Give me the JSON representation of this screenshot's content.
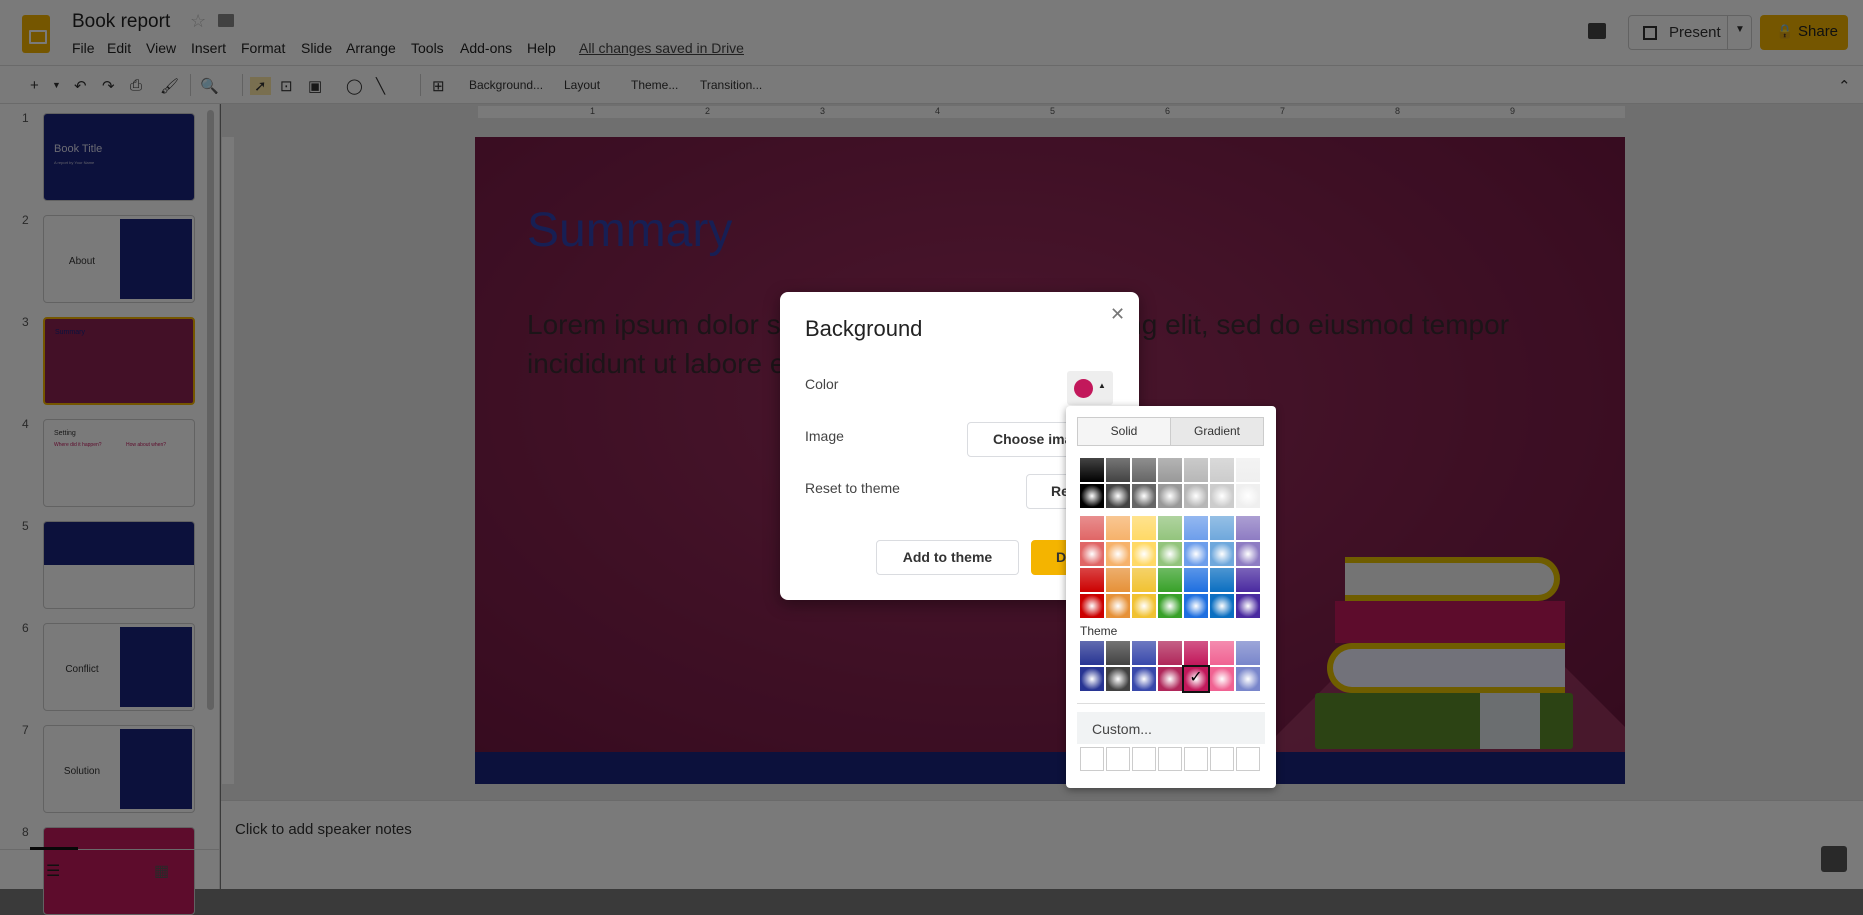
{
  "header": {
    "title": "Book report",
    "menu": [
      "File",
      "Edit",
      "View",
      "Insert",
      "Format",
      "Slide",
      "Arrange",
      "Tools",
      "Add-ons",
      "Help"
    ],
    "save_status": "All changes saved in Drive",
    "present_label": "Present",
    "share_label": "Share",
    "share_color": "#f4b400"
  },
  "toolbar": {
    "background": "Background...",
    "layout": "Layout",
    "theme": "Theme...",
    "transition": "Transition..."
  },
  "filmstrip": {
    "slides": [
      {
        "n": "1",
        "label": "Book Title",
        "sub": "A report by Your Name"
      },
      {
        "n": "2",
        "label": "About"
      },
      {
        "n": "3",
        "label": "Summary"
      },
      {
        "n": "4",
        "label": "Setting",
        "left": "Where did it happen?",
        "right": "How about when?"
      },
      {
        "n": "5",
        "label": ""
      },
      {
        "n": "6",
        "label": "Conflict"
      },
      {
        "n": "7",
        "label": "Solution"
      },
      {
        "n": "8",
        "label": ""
      }
    ],
    "selected": 3
  },
  "slide": {
    "title": "Summary",
    "body": "Lorem ipsum dolor sit amet, consectetur adipiscing elit, sed do eiusmod tempor incididunt ut labore et dolore magna aliqua."
  },
  "notes": {
    "placeholder": "Click to add speaker notes"
  },
  "dialog": {
    "title": "Background",
    "color_label": "Color",
    "image_label": "Image",
    "image_button": "Choose image",
    "reset_label": "Reset to theme",
    "reset_button": "Reset",
    "add_button": "Add to theme",
    "done_button": "Done",
    "current_color": "#c2185b"
  },
  "popup": {
    "tabs": [
      "Solid",
      "Gradient"
    ],
    "active_tab": "Gradient",
    "theme_label": "Theme",
    "custom_label": "Custom...",
    "grays": [
      "#000000",
      "#434343",
      "#666666",
      "#999999",
      "#b7b7b7",
      "#cccccc",
      "#efefef"
    ],
    "lights": [
      "#e06666",
      "#f6b26b",
      "#ffd966",
      "#93c47d",
      "#6d9eeb",
      "#6fa8dc",
      "#8e7cc3"
    ],
    "darks": [
      "#cc0000",
      "#e69138",
      "#f1c232",
      "#38a129",
      "#1e6fe0",
      "#0b6fc1",
      "#4a2aa0"
    ],
    "theme": [
      "#283593",
      "#424242",
      "#3949ab",
      "#b0275a",
      "#c2185b",
      "#f06292",
      "#7986cb"
    ],
    "selected_theme_index": 4
  }
}
